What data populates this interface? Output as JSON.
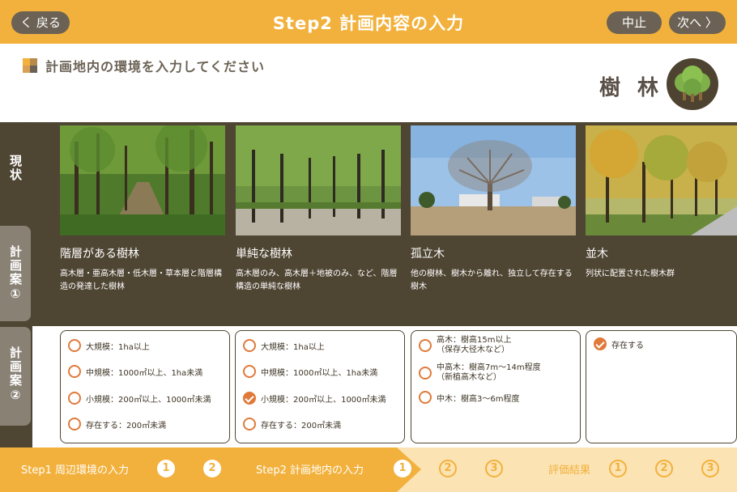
{
  "header": {
    "title": "Step2 計画内容の入力",
    "back_label": "く 戻る",
    "stop_label": "中止",
    "next_label": "次へ 〉"
  },
  "instruction": "計画地内の環境を入力してください",
  "category": {
    "label": "樹 林",
    "icon": "tree-icon"
  },
  "side_tabs": [
    "現状",
    "計画案①",
    "計画案②"
  ],
  "cards": [
    {
      "name": "階層がある樹林",
      "desc": "高木層・亜高木層・低木層・草本層と階層構造の発達した樹林"
    },
    {
      "name": "単純な樹林",
      "desc": "高木層のみ、高木層＋地被のみ、など、階層構造の単純な樹林"
    },
    {
      "name": "孤立木",
      "desc": "他の樹林、樹木から離れ、独立して存在する樹木"
    },
    {
      "name": "並木",
      "desc": "列状に配置された樹木群"
    }
  ],
  "options": [
    {
      "items": [
        {
          "label": "大規模：1ha以上",
          "checked": false
        },
        {
          "label": "中規模：1000㎡以上、1ha未満",
          "checked": false
        },
        {
          "label": "小規模：200㎡以上、1000㎡未満",
          "checked": false
        },
        {
          "label": "存在する：200㎡未満",
          "checked": false
        }
      ]
    },
    {
      "items": [
        {
          "label": "大規模：1ha以上",
          "checked": false
        },
        {
          "label": "中規模：1000㎡以上、1ha未満",
          "checked": false
        },
        {
          "label": "小規模：200㎡以上、1000㎡未満",
          "checked": true
        },
        {
          "label": "存在する：200㎡未満",
          "checked": false
        }
      ]
    },
    {
      "items": [
        {
          "label": "高木：樹高15m以上",
          "sub": "（保存大径木など）",
          "checked": false
        },
        {
          "label": "中高木：樹高7m～14m程度",
          "sub": "（新植高木など）",
          "checked": false
        },
        {
          "label": "中木：樹高3～6m程度",
          "sub": "",
          "checked": false
        }
      ]
    },
    {
      "items": [
        {
          "label": "存在する",
          "checked": true
        }
      ]
    }
  ],
  "progress": {
    "step1": "Step1 周辺環境の入力",
    "step2": "Step2 計画地内の入力",
    "result": "評価結果",
    "n1": "1",
    "n2": "2",
    "n3": "3"
  },
  "colors": {
    "accent": "#f2b13c",
    "panel": "#4f4533",
    "radio": "#e07a3a"
  }
}
